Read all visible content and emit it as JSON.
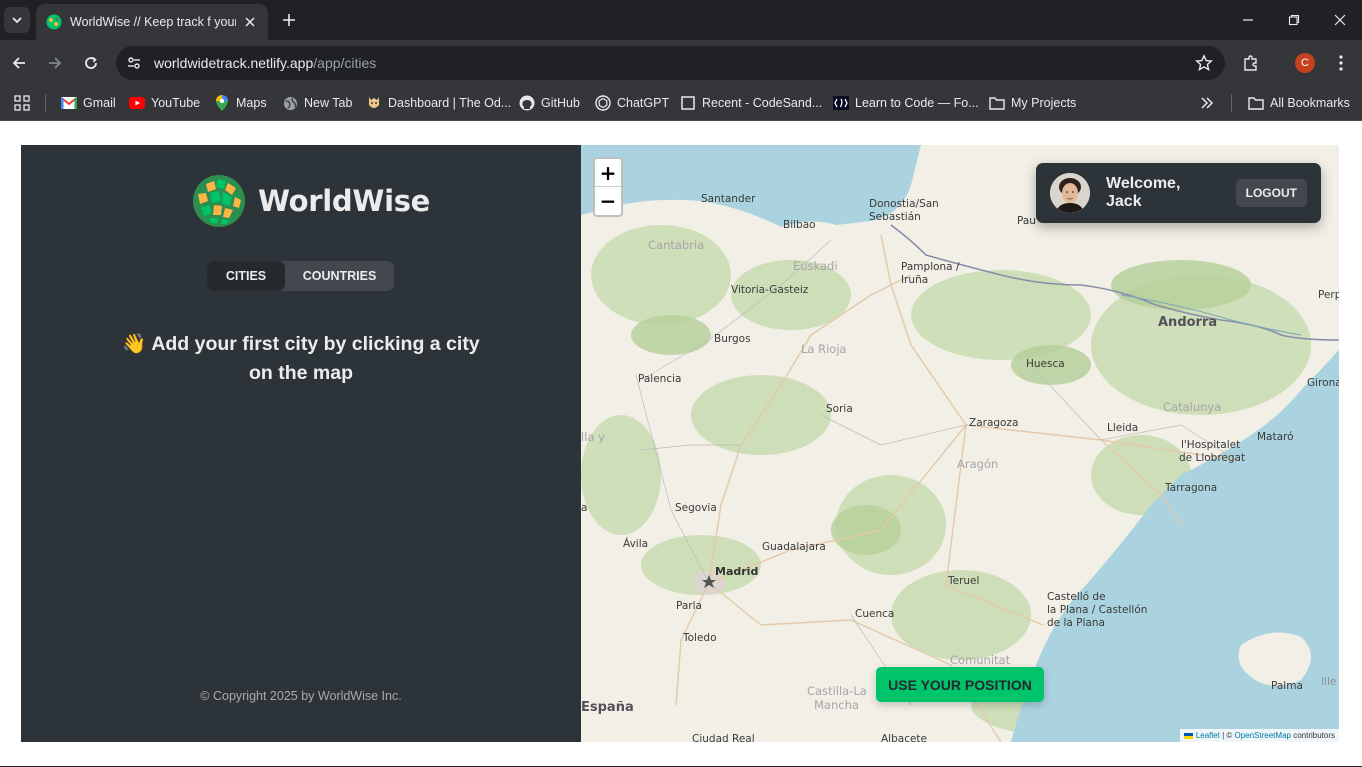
{
  "browser": {
    "tab_title": "WorldWise // Keep track f your",
    "url_host": "worldwidetrack.netlify.app",
    "url_path": "/app/cities",
    "profile_initial": "C",
    "bookmarks": [
      {
        "label": "Gmail",
        "icon": "gmail-icon"
      },
      {
        "label": "YouTube",
        "icon": "youtube-icon"
      },
      {
        "label": "Maps",
        "icon": "maps-icon"
      },
      {
        "label": "New Tab",
        "icon": "globe-icon"
      },
      {
        "label": "Dashboard | The Od...",
        "icon": "odin-icon"
      },
      {
        "label": "GitHub",
        "icon": "github-icon"
      },
      {
        "label": "ChatGPT",
        "icon": "chatgpt-icon"
      },
      {
        "label": "Recent - CodeSand...",
        "icon": "codesandbox-icon"
      },
      {
        "label": "Learn to Code — Fo...",
        "icon": "freecodecamp-icon"
      },
      {
        "label": "My Projects",
        "icon": "folder-icon"
      }
    ],
    "all_bookmarks": "All Bookmarks"
  },
  "sidebar": {
    "brand": "WorldWise",
    "tabs": [
      {
        "label": "Cities",
        "active": true
      },
      {
        "label": "Countries",
        "active": false
      }
    ],
    "message_emoji": "👋",
    "message": "Add your first city by clicking a city on the map",
    "copyright": "© Copyright 2025 by WorldWise Inc."
  },
  "map": {
    "zoom_in": "+",
    "zoom_out": "−",
    "user": {
      "welcome": "Welcome, Jack",
      "logout": "Logout"
    },
    "use_position": "USE YOUR POSITION",
    "attribution": {
      "leaflet": "Leaflet",
      "sep": " | © ",
      "osm": "OpenStreetMap",
      "suffix": " contributors"
    },
    "labels": {
      "santander": "Santander",
      "bilbao": "Bilbao",
      "donostia1": "Donostia/San",
      "donostia2": "Sebastián",
      "pau": "Pau",
      "cantabria": "Cantabria",
      "euskadi": "Euskadi",
      "vitoria": "Vitoria-Gasteiz",
      "pamplona1": "Pamplona /",
      "pamplona2": "Iruña",
      "perpi": "Perpi",
      "andorra": "Andorra",
      "burgos": "Burgos",
      "larioja": "La Rioja",
      "huesca": "Huesca",
      "palencia": "Palencia",
      "girona": "Girona",
      "soria": "Soria",
      "catalunya": "Catalunya",
      "zaragoza": "Zaragoza",
      "lleida": "Lleida",
      "lly": "lla y",
      "hospitalet1": "l'Hospitalet",
      "hospitalet2": "de Llobregat",
      "mataro": "Mataró",
      "aragon": "Aragón",
      "tarragona": "Tarragona",
      "segovia": "Segovia",
      "a": "a",
      "avila": "Ávila",
      "guadalajara": "Guadalajara",
      "madrid": "Madrid",
      "teruel": "Teruel",
      "castello1": "Castelló de",
      "castello2": "la Plana / Castellón",
      "castello3": "de la Plana",
      "parla": "Parla",
      "cuenca": "Cuenca",
      "toledo": "Toledo",
      "comunitat": "Comunitat",
      "palma": "Palma",
      "ille": "Ille",
      "castilla1": "Castilla-La",
      "castilla2": "Mancha",
      "espana": "España",
      "ciudadreal": "Ciudad Real",
      "albacete": "Albacete"
    }
  },
  "colors": {
    "sidebar_bg": "#2d3439",
    "tab_active_bg": "#242a2e",
    "brand_green": "#00c46a",
    "sea": "#aad3df"
  }
}
